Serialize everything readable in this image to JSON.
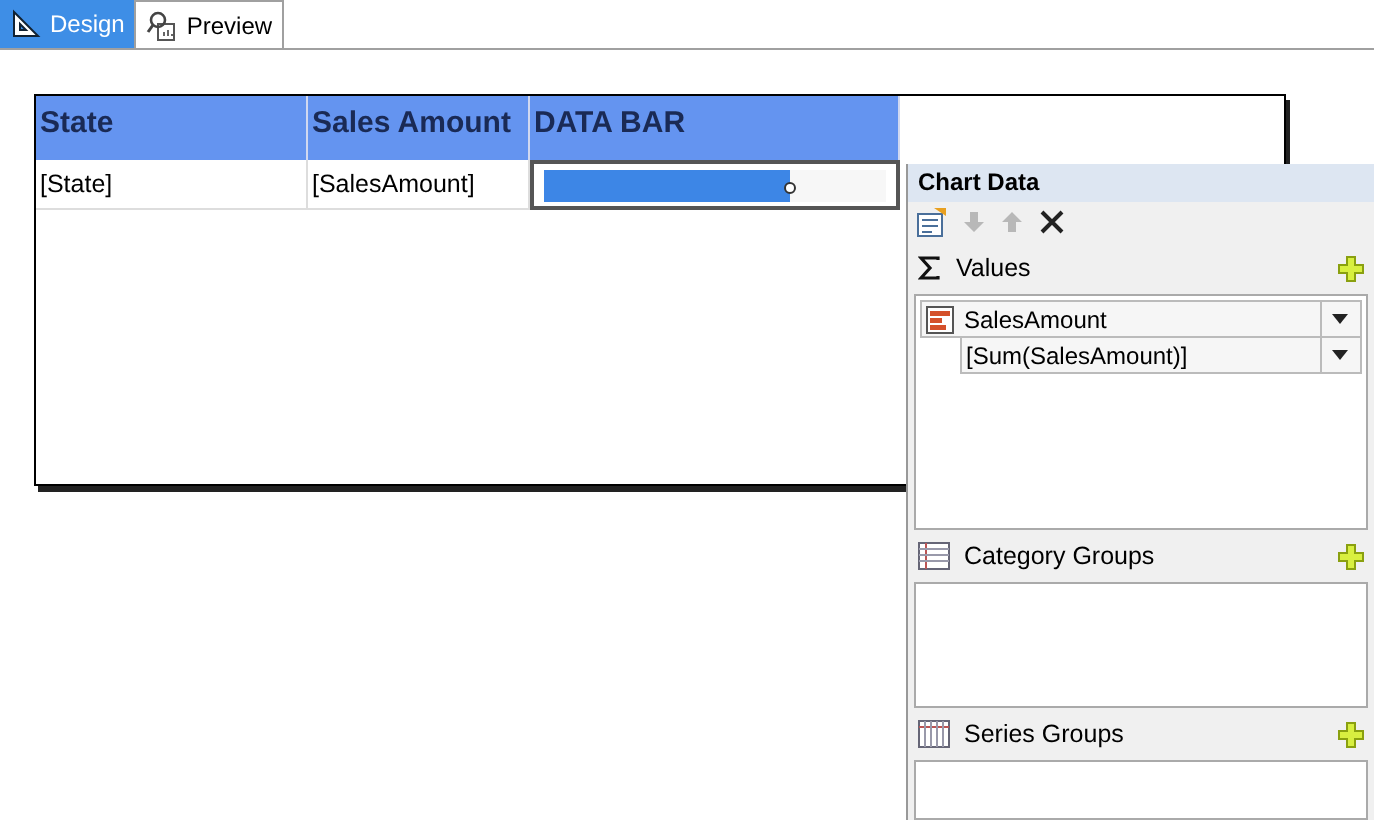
{
  "tabs": [
    {
      "label": "Design",
      "selected": true,
      "kind": "design"
    },
    {
      "label": "Preview",
      "selected": false,
      "kind": "preview"
    }
  ],
  "table": {
    "columns": [
      "State",
      "Sales Amount",
      "DATA BAR"
    ],
    "rows": [
      {
        "cells": [
          "[State]",
          "[SalesAmount]"
        ],
        "data_bar": {
          "level": 0.72,
          "selected": true
        }
      }
    ]
  },
  "chart_data_panel": {
    "title": "Chart Data",
    "toolbar": [
      {
        "kind": "properties",
        "disabled": false
      },
      {
        "kind": "move-down",
        "disabled": true
      },
      {
        "kind": "move-up",
        "disabled": true
      },
      {
        "kind": "delete",
        "disabled": false
      }
    ],
    "sections": [
      {
        "kind": "values",
        "title": "Values",
        "items": [
          {
            "label": "SalesAmount",
            "children": [
              {
                "label": "[Sum(SalesAmount)]"
              }
            ]
          }
        ]
      },
      {
        "kind": "category",
        "title": "Category Groups"
      },
      {
        "kind": "series",
        "title": "Series Groups"
      }
    ]
  }
}
